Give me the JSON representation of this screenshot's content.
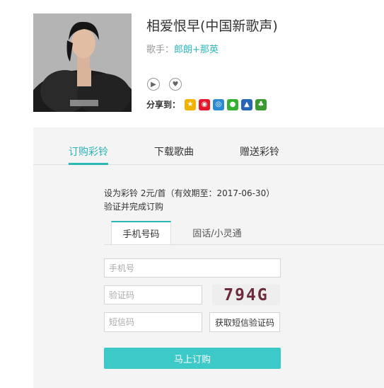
{
  "song": {
    "title": "相爱恨早(中国新歌声)",
    "singer_label": "歌手：",
    "singer_names": "郎朗+那英"
  },
  "actions": {
    "play_icon": "play-icon",
    "favorite_icon": "heart-icon"
  },
  "share": {
    "label": "分享到：",
    "icons": [
      {
        "name": "qzone-icon",
        "color": "#f0b400"
      },
      {
        "name": "weibo-icon",
        "color": "#e6162d"
      },
      {
        "name": "tencent-weibo-icon",
        "color": "#2b8ad1"
      },
      {
        "name": "wechat-icon",
        "color": "#31b031"
      },
      {
        "name": "renren-icon",
        "color": "#2566b8"
      },
      {
        "name": "kaixin-icon",
        "color": "#3b9a2f"
      }
    ]
  },
  "tabs": {
    "subscribe": "订购彩铃",
    "download": "下载歌曲",
    "gift": "赠送彩铃"
  },
  "subscribe": {
    "info_line1": "设为彩铃 2元/首（有效期至：2017-06-30）",
    "info_line2": "验证并完成订购",
    "subtab_mobile": "手机号码",
    "subtab_landline": "固话/小灵通",
    "phone_placeholder": "手机号",
    "captcha_placeholder": "验证码",
    "captcha_text": "794G",
    "sms_placeholder": "短信码",
    "sms_button": "获取短信验证码",
    "buy_button": "马上订购"
  },
  "colors": {
    "accent": "#2bb5b5",
    "button": "#3cc9c8"
  }
}
